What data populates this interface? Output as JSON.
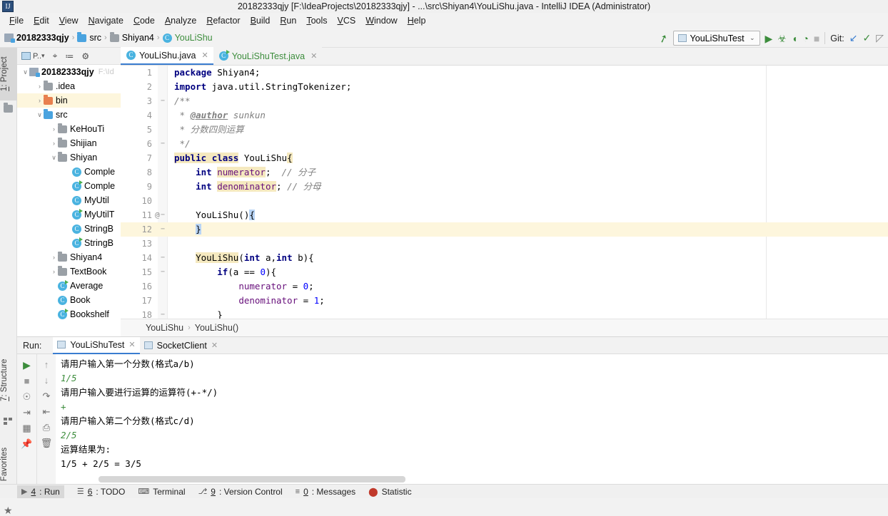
{
  "window": {
    "title": "20182333qjy [F:\\IdeaProjects\\20182333qjy] - ...\\src\\Shiyan4\\YouLiShu.java - IntelliJ IDEA (Administrator)",
    "app_icon": "idea-logo-icon"
  },
  "menubar": {
    "items": [
      {
        "mnemonic": "F",
        "rest": "ile"
      },
      {
        "mnemonic": "E",
        "rest": "dit"
      },
      {
        "mnemonic": "V",
        "rest": "iew"
      },
      {
        "mnemonic": "N",
        "rest": "avigate"
      },
      {
        "mnemonic": "C",
        "rest": "ode"
      },
      {
        "mnemonic": "A",
        "rest": "nalyze"
      },
      {
        "mnemonic": "R",
        "rest": "efactor"
      },
      {
        "mnemonic": "B",
        "rest": "uild"
      },
      {
        "mnemonic": "R",
        "rest": "un"
      },
      {
        "mnemonic": "T",
        "rest": "ools"
      },
      {
        "mnemonic": "V",
        "rest": "CS"
      },
      {
        "mnemonic": "W",
        "rest": "indow"
      },
      {
        "mnemonic": "H",
        "rest": "elp"
      }
    ]
  },
  "navbar": {
    "breadcrumbs": [
      {
        "label": "20182333qjy",
        "icon": "module-icon",
        "bold": true
      },
      {
        "label": "src",
        "icon": "folder-icon",
        "bold": false
      },
      {
        "label": "Shiyan4",
        "icon": "package-icon",
        "bold": false
      },
      {
        "label": "YouLiShu",
        "icon": "class-icon",
        "bold": false,
        "green": true
      }
    ],
    "build_icon": "hammer-icon",
    "run_configuration": "YouLiShuTest",
    "run_config_caret": "⌄",
    "buttons": [
      {
        "name": "run-button",
        "glyph": "▶"
      },
      {
        "name": "debug-button",
        "glyph": "☸"
      },
      {
        "name": "run-with-coverage-button",
        "glyph": "◖"
      },
      {
        "name": "profile-button",
        "glyph": "◔"
      },
      {
        "name": "stop-button",
        "glyph": "■",
        "disabled": true
      }
    ],
    "git_label": "Git:",
    "git_buttons": [
      {
        "name": "git-update-project-icon",
        "glyph": "↙"
      },
      {
        "name": "git-commit-icon",
        "glyph": "✓"
      },
      {
        "name": "git-history-icon",
        "glyph": "◴"
      }
    ]
  },
  "left_strip": {
    "project_tab": {
      "num": "1",
      "label": ": Project",
      "icon": "folder-icon"
    },
    "structure_tab": {
      "num": "7",
      "label": ": Structure",
      "icon": "structure-icon"
    },
    "favorites_tab": {
      "num": "2",
      "label": ": Favorites",
      "icon": "star-icon"
    }
  },
  "project_panel": {
    "toolbar_icons": [
      "project-view-selector",
      "locate-icon",
      "collapse-all-icon",
      "settings-gear-icon"
    ],
    "toolbar_selector_label": "P..",
    "tree": [
      {
        "label": "20182333qjy",
        "path": "F:\\Id",
        "arrow": "∨",
        "icon": "module-icon",
        "indent": 0,
        "bold": true,
        "highlight": false
      },
      {
        "label": ".idea",
        "arrow": "›",
        "icon": "folder-grey-icon",
        "indent": 1,
        "bold": false,
        "highlight": false
      },
      {
        "label": "bin",
        "arrow": "›",
        "icon": "folder-orange-icon",
        "indent": 1,
        "bold": false,
        "highlight": true
      },
      {
        "label": "src",
        "arrow": "∨",
        "icon": "folder-blue-icon",
        "indent": 1,
        "bold": false,
        "highlight": false
      },
      {
        "label": "KeHouTi",
        "arrow": "›",
        "icon": "package-icon",
        "indent": 2,
        "bold": false,
        "highlight": false
      },
      {
        "label": "Shijian",
        "arrow": "›",
        "icon": "package-icon",
        "indent": 2,
        "bold": false,
        "highlight": false
      },
      {
        "label": "Shiyan",
        "arrow": "∨",
        "icon": "package-icon",
        "indent": 2,
        "bold": false,
        "highlight": false
      },
      {
        "label": "Comple",
        "arrow": "",
        "icon": "class-icon",
        "indent": 3,
        "bold": false,
        "highlight": false
      },
      {
        "label": "Comple",
        "arrow": "",
        "icon": "class-runnable-icon",
        "indent": 3,
        "bold": false,
        "highlight": false
      },
      {
        "label": "MyUtil",
        "arrow": "",
        "icon": "class-icon",
        "indent": 3,
        "bold": false,
        "highlight": false
      },
      {
        "label": "MyUtilT",
        "arrow": "",
        "icon": "class-runnable-icon",
        "indent": 3,
        "bold": false,
        "highlight": false
      },
      {
        "label": "StringB",
        "arrow": "",
        "icon": "class-icon",
        "indent": 3,
        "bold": false,
        "highlight": false
      },
      {
        "label": "StringB",
        "arrow": "",
        "icon": "class-runnable-icon",
        "indent": 3,
        "bold": false,
        "highlight": false
      },
      {
        "label": "Shiyan4",
        "arrow": "›",
        "icon": "package-icon",
        "indent": 2,
        "bold": false,
        "highlight": false
      },
      {
        "label": "TextBook",
        "arrow": "›",
        "icon": "package-icon",
        "indent": 2,
        "bold": false,
        "highlight": false
      },
      {
        "label": "Average",
        "arrow": "",
        "icon": "class-runnable-icon",
        "indent": 2,
        "bold": false,
        "highlight": false
      },
      {
        "label": "Book",
        "arrow": "",
        "icon": "class-icon",
        "indent": 2,
        "bold": false,
        "highlight": false
      },
      {
        "label": "Bookshelf",
        "arrow": "",
        "icon": "class-runnable-icon",
        "indent": 2,
        "bold": false,
        "highlight": false
      }
    ]
  },
  "editor": {
    "tabs": [
      {
        "label": "YouLiShu.java",
        "icon": "class-icon",
        "active": true,
        "test": false
      },
      {
        "label": "YouLiShuTest.java",
        "icon": "class-runnable-icon",
        "active": false,
        "test": true
      }
    ],
    "breadcrumb": [
      "YouLiShu",
      "YouLiShu()"
    ],
    "lines": [
      {
        "n": "1",
        "fold": "",
        "ann": "",
        "hl": false
      },
      {
        "n": "2",
        "fold": "",
        "ann": "",
        "hl": false
      },
      {
        "n": "3",
        "fold": "−",
        "ann": "",
        "hl": false
      },
      {
        "n": "4",
        "fold": "",
        "ann": "",
        "hl": false
      },
      {
        "n": "5",
        "fold": "",
        "ann": "",
        "hl": false
      },
      {
        "n": "6",
        "fold": "−",
        "ann": "",
        "hl": false
      },
      {
        "n": "7",
        "fold": "",
        "ann": "",
        "hl": false
      },
      {
        "n": "8",
        "fold": "",
        "ann": "",
        "hl": false
      },
      {
        "n": "9",
        "fold": "",
        "ann": "",
        "hl": false
      },
      {
        "n": "10",
        "fold": "",
        "ann": "",
        "hl": false
      },
      {
        "n": "11",
        "fold": "−",
        "ann": "@",
        "hl": false
      },
      {
        "n": "12",
        "fold": "−",
        "ann": "",
        "hl": true
      },
      {
        "n": "13",
        "fold": "",
        "ann": "",
        "hl": false
      },
      {
        "n": "14",
        "fold": "−",
        "ann": "",
        "hl": false
      },
      {
        "n": "15",
        "fold": "−",
        "ann": "",
        "hl": false
      },
      {
        "n": "16",
        "fold": "",
        "ann": "",
        "hl": false
      },
      {
        "n": "17",
        "fold": "",
        "ann": "",
        "hl": false
      },
      {
        "n": "18",
        "fold": "−",
        "ann": "",
        "hl": false
      }
    ],
    "code_text": [
      "package Shiyan4;",
      "import java.util.StringTokenizer;",
      "/**",
      " * @author sunkun",
      " * 分数四则运算",
      " */",
      "public class YouLiShu{",
      "    int numerator;  // 分子",
      "    int denominator; // 分母",
      "",
      "    YouLiShu(){",
      "    }",
      "",
      "    YouLiShu(int a,int b){",
      "        if(a == 0){",
      "            numerator = 0;",
      "            denominator = 1;",
      "        }"
    ]
  },
  "run_panel": {
    "label": "Run:",
    "tabs": [
      {
        "label": "YouLiShuTest",
        "active": true
      },
      {
        "label": "SocketClient",
        "active": false
      }
    ],
    "tool_icons_left": [
      "rerun-icon",
      "stop-icon",
      "screenshot-icon",
      "export-icon",
      "print-settings-icon",
      "pin-icon"
    ],
    "tool_icons_right": [
      "scroll-up-icon",
      "scroll-down-icon",
      "soft-wrap-icon",
      "scroll-to-end-icon",
      "print-icon",
      "trash-icon"
    ],
    "console_output": [
      {
        "text": "请用户输入第一个分数(格式a/b)",
        "input": false
      },
      {
        "text": "1/5",
        "input": true
      },
      {
        "text": "请用户输入要进行运算的运算符(+-*/)",
        "input": false
      },
      {
        "text": "+",
        "input": true
      },
      {
        "text": "请用户输入第二个分数(格式c/d)",
        "input": false
      },
      {
        "text": "2/5",
        "input": true
      },
      {
        "text": "运算结果为:",
        "input": false
      },
      {
        "text": "1/5 + 2/5 = 3/5",
        "input": false
      }
    ]
  },
  "statusbar": {
    "items": [
      {
        "num": "4",
        "label": ": Run",
        "icon": "play-icon",
        "selected": true
      },
      {
        "num": "6",
        "label": ": TODO",
        "icon": "todo-list-icon",
        "selected": false
      },
      {
        "num": "",
        "label": "Terminal",
        "icon": "terminal-icon",
        "selected": false
      },
      {
        "num": "9",
        "label": ": Version Control",
        "icon": "version-control-icon",
        "selected": false
      },
      {
        "num": "0",
        "label": ": Messages",
        "icon": "messages-icon",
        "selected": false
      },
      {
        "num": "",
        "label": "Statistic",
        "icon": "statistic-icon",
        "selected": false
      }
    ]
  },
  "colors": {
    "accent_blue": "#3a7dd0",
    "green": "#3c8d3c",
    "highlight_yellow": "#fdf6dd",
    "keyword_navy": "#000080",
    "field_purple": "#660e7a"
  }
}
